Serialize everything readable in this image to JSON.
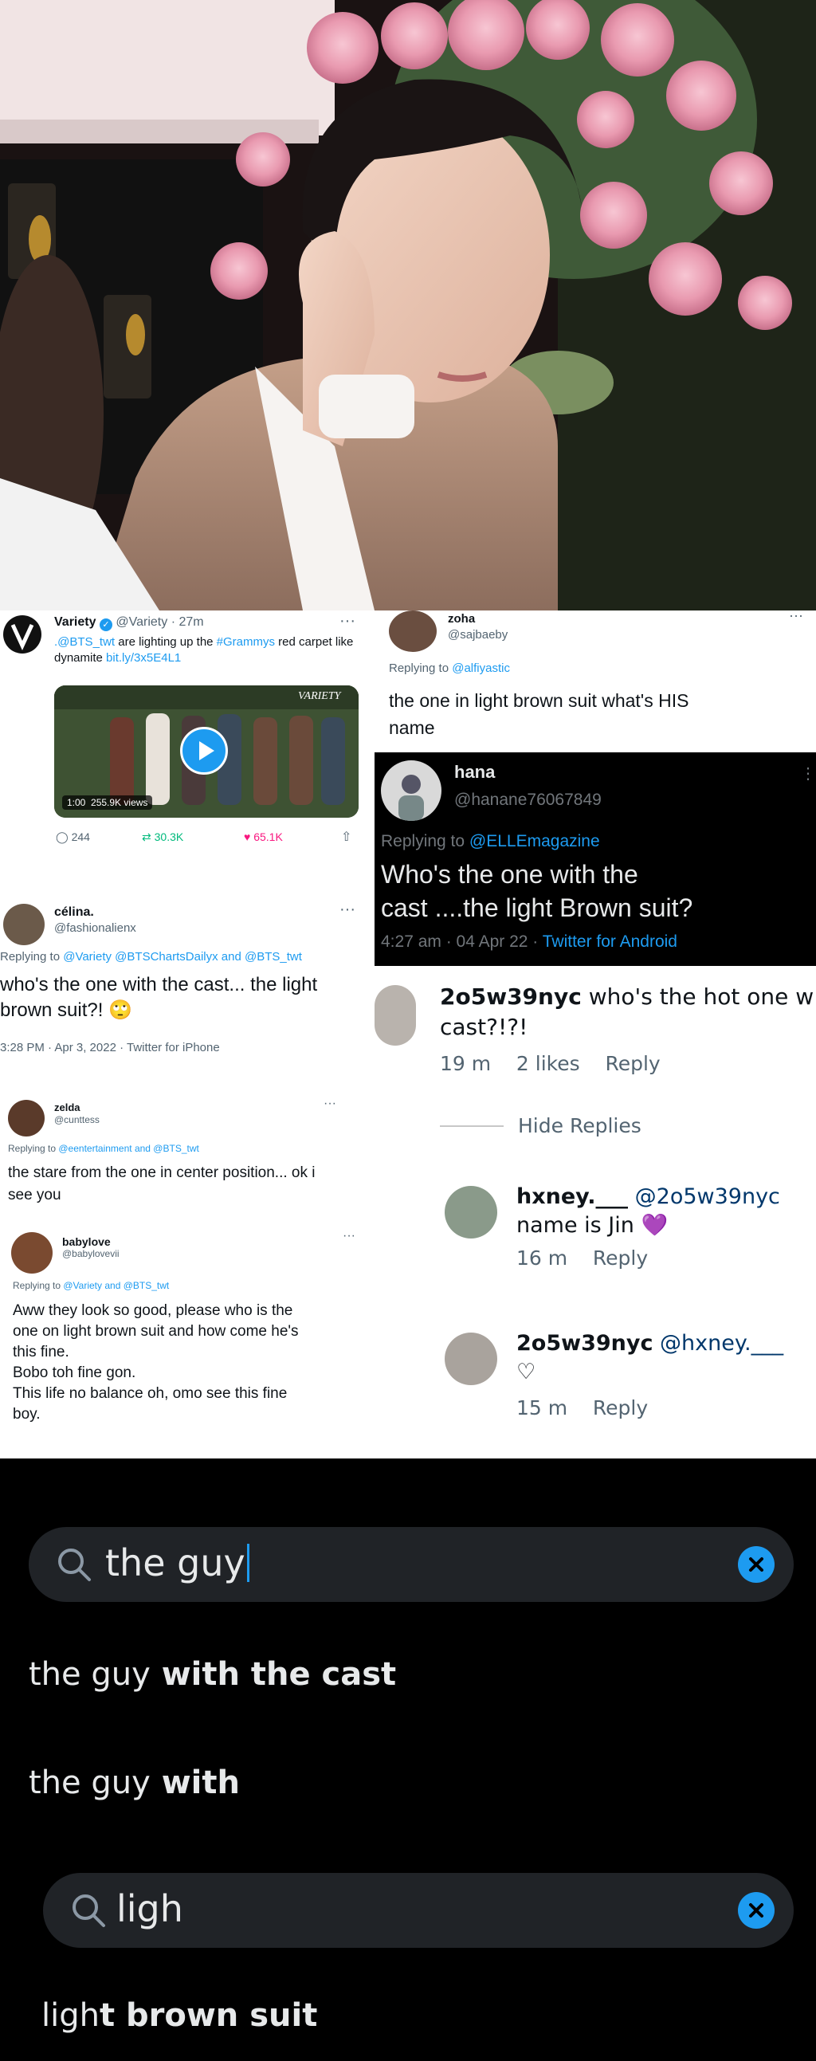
{
  "variety": {
    "name": "Variety",
    "handle": "@Variety",
    "time": "27m",
    "text_mention": ".@BTS_twt",
    "text_1": " are lighting up the ",
    "hashtag": "#Grammys",
    "text_2": " red carpet like dynamite",
    "link": "bit.ly/3x5E4L1",
    "video_duration": "1:00",
    "video_views": "255.9K views",
    "video_brand": "VARIETY",
    "replies": "244",
    "retweets": "30.3K",
    "likes": "65.1K"
  },
  "celina": {
    "name": "célina.",
    "handle": "@fashionalienx",
    "replying_prefix": "Replying to ",
    "replying_to": "@Variety @BTSChartsDailyx and @BTS_twt",
    "text": "who's the one with the cast... the light brown suit?!",
    "meta": "3:28 PM · Apr 3, 2022 · Twitter for iPhone"
  },
  "zelda": {
    "name": "zelda",
    "handle": "@cunttess",
    "replying_prefix": "Replying to ",
    "replying_to": "@eentertainment and @BTS_twt",
    "text": "the stare from the one in center position... ok i see you"
  },
  "babylove": {
    "name": "babylove",
    "handle": "@babylovevii",
    "replying_prefix": "Replying to ",
    "replying_to": "@Variety and @BTS_twt",
    "line1": "Aww they look so good, please who is the",
    "line2": "one on light brown suit and how come he's",
    "line3": "this fine.",
    "line4": "Bobo toh fine gon.",
    "line5": "This life no balance oh, omo see this fine",
    "line6": "boy."
  },
  "zoha": {
    "name": "zoha",
    "handle": "@sajbaeby",
    "replying_prefix": "Replying to ",
    "replying_to": "@alfiyastic",
    "line1": "the one in light brown suit what's HIS",
    "line2": "name"
  },
  "hana": {
    "name": "hana",
    "handle": "@hanane76067849",
    "replying_prefix": "Replying to ",
    "replying_to": "@ELLEmagazine",
    "line1": "Who's the one with the",
    "line2": "cast ....the light Brown suit?",
    "meta": "4:27 am · 04 Apr 22 · ",
    "client": "Twitter for Android"
  },
  "ig": {
    "c1_user": "2o5w39nyc",
    "c1_text": " who's the hot one w",
    "c1_text2": "cast?!?!",
    "c1_time": "19 m",
    "c1_likes": "2 likes",
    "c1_reply": "Reply",
    "hide_replies": "Hide Replies",
    "c2_user": "hxney.___",
    "c2_mention": " @2o5w39nyc",
    "c2_text2": "name is Jin 💜",
    "c2_time": "16 m",
    "c2_reply": "Reply",
    "c3_user": "2o5w39nyc",
    "c3_mention": " @hxney.___",
    "c3_text2": "♡",
    "c3_time": "15 m",
    "c3_reply": "Reply"
  },
  "search": {
    "query1": "the guy",
    "suggestions1": [
      {
        "typed": "the guy",
        "rest": " with the cast"
      },
      {
        "typed": "the guy",
        "rest": " with"
      }
    ],
    "query2": "ligh",
    "suggestions2": [
      {
        "typed": "ligh",
        "rest": "t brown suit"
      }
    ]
  },
  "icons": {
    "search": "search-icon",
    "clear": "clear-icon",
    "play": "play-icon",
    "more": "more-icon",
    "reply": "reply-icon",
    "retweet": "retweet-icon",
    "like": "heart-icon",
    "share": "share-icon",
    "verified": "verified-badge-icon"
  },
  "colors": {
    "twitter_blue": "#1d9bf0",
    "like_pink": "#f91880",
    "retweet_green": "#00ba7c",
    "search_bg": "#202327"
  }
}
